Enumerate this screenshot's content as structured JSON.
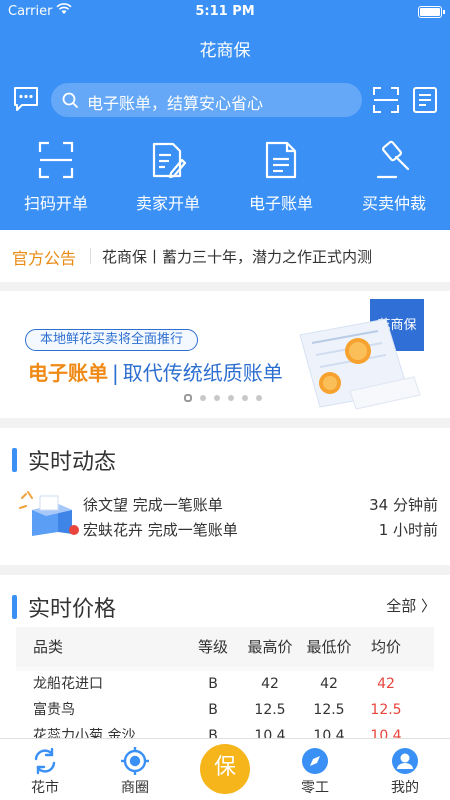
{
  "status_bar": {
    "carrier": "Carrier",
    "time": "5:11 PM"
  },
  "header": {
    "title": "花商保",
    "search_placeholder": "电子账单，结算安心省心"
  },
  "quick_actions": [
    {
      "label": "扫码开单",
      "icon": "scan-icon"
    },
    {
      "label": "卖家开单",
      "icon": "edit-document-icon"
    },
    {
      "label": "电子账单",
      "icon": "document-icon"
    },
    {
      "label": "买卖仲裁",
      "icon": "gavel-icon"
    }
  ],
  "notice": {
    "tag": "官方公告",
    "text": "花商保丨蓄力三十年，潜力之作正式内测"
  },
  "banner": {
    "pill": "本地鲜花买卖将全面推行",
    "headline_orange": "电子账单",
    "headline_bar": "|",
    "headline_blue": "取代传统纸质账单",
    "slides": 6,
    "active_slide": 1
  },
  "activity": {
    "title": "实时动态",
    "items": [
      {
        "who": "徐文望 完成一笔账单",
        "when": "34 分钟前"
      },
      {
        "who": "宏蚨花卉 完成一笔账单",
        "when": "1 小时前"
      }
    ]
  },
  "prices": {
    "title": "实时价格",
    "more": "全部 〉",
    "headers": {
      "name": "品类",
      "grade": "等级",
      "max": "最高价",
      "min": "最低价",
      "avg": "均价"
    },
    "rows": [
      {
        "name": "龙船花进口",
        "grade": "B",
        "max": "42",
        "min": "42",
        "avg": "42"
      },
      {
        "name": "富贵鸟",
        "grade": "B",
        "max": "12.5",
        "min": "12.5",
        "avg": "12.5"
      },
      {
        "name": "花蕊力小菊 金沙",
        "grade": "B",
        "max": "10.4",
        "min": "10.4",
        "avg": "10.4"
      }
    ]
  },
  "tabbar": {
    "tabs": [
      {
        "label": "花市",
        "icon": "refresh-icon"
      },
      {
        "label": "商圈",
        "icon": "target-icon"
      },
      {
        "label": "零工",
        "icon": "compass-icon"
      },
      {
        "label": "我的",
        "icon": "profile-icon"
      }
    ],
    "center": "保"
  },
  "colors": {
    "primary": "#3a90f5",
    "orange": "#f08a16",
    "red": "#e8453c",
    "gold": "#f5b51b"
  }
}
